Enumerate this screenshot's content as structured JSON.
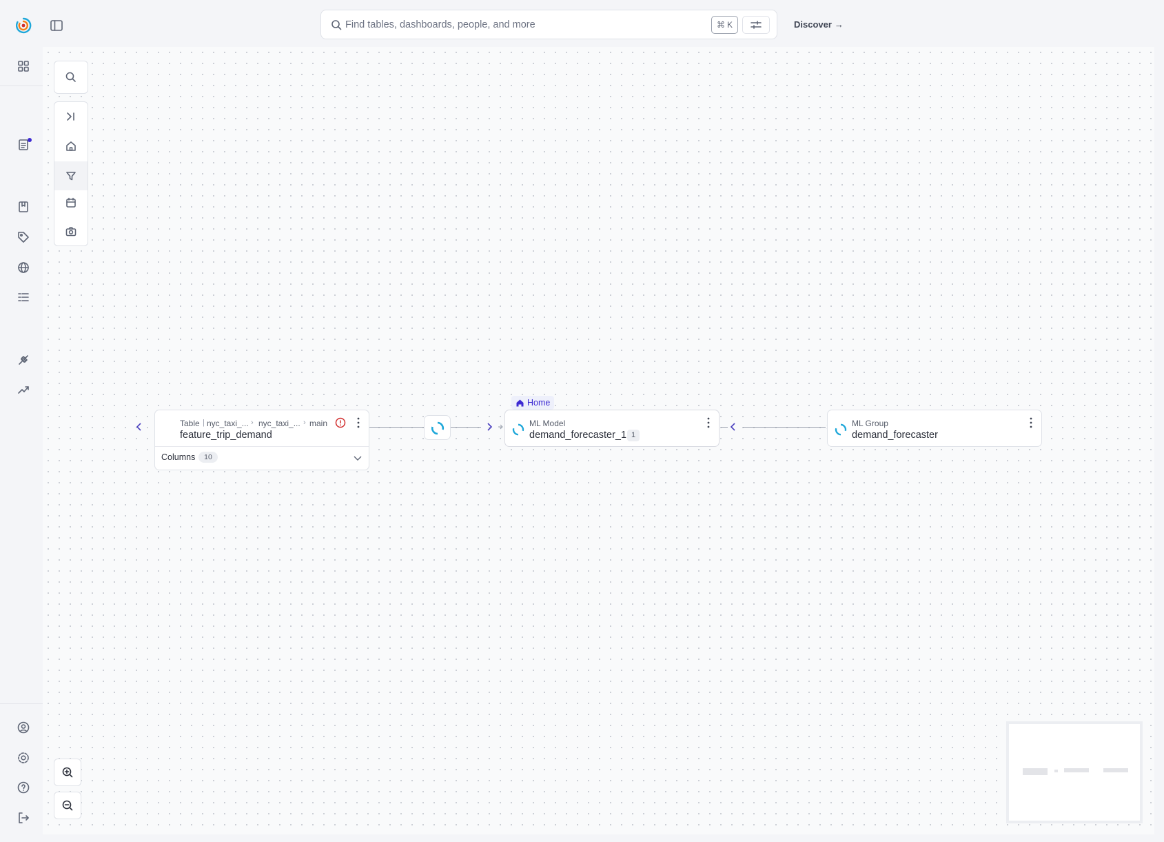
{
  "search": {
    "placeholder": "Find tables, dashboards, people, and more",
    "shortcut_symbol": "⌘",
    "shortcut_key": "K"
  },
  "header": {
    "discover_label": "Discover",
    "discover_arrow": "→"
  },
  "sidebar": {
    "icons": [
      "grid-icon",
      "document-icon",
      "book-icon",
      "tag-icon",
      "globe-icon",
      "list-icon",
      "plug-icon",
      "trend-icon"
    ],
    "footer_icons": [
      "user-icon",
      "settings-icon",
      "help-icon",
      "logout-icon"
    ]
  },
  "toolbar": {
    "tools": [
      "search-icon",
      "collapse-right-icon",
      "home-icon",
      "filter-icon",
      "calendar-icon",
      "camera-icon"
    ]
  },
  "lineage": {
    "home_tag": "Home",
    "nodes": {
      "table": {
        "type": "Table",
        "crumbs": [
          "nyc_taxi_...",
          "nyc_taxi_...",
          "main"
        ],
        "name": "feature_trip_demand",
        "columns_label": "Columns",
        "columns_count": "10"
      },
      "model": {
        "type": "ML Model",
        "name": "demand_forecaster_1",
        "badge": "1"
      },
      "group": {
        "type": "ML Group",
        "name": "demand_forecaster"
      }
    }
  },
  "colors": {
    "accent": "#3d2ad2",
    "error": "#d12d2d",
    "ml_icon": "#1ea7d9"
  }
}
